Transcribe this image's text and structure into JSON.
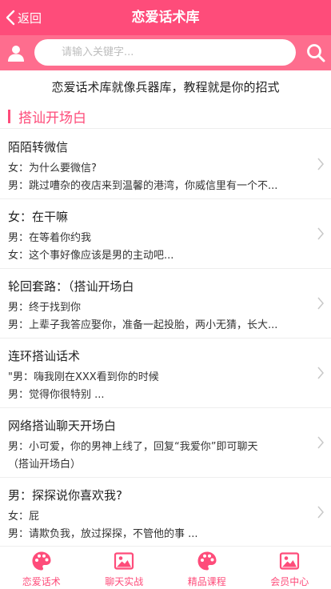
{
  "header": {
    "back_label": "返回",
    "title": "恋爱话术库",
    "back_icon": "chevron-left-icon"
  },
  "search": {
    "placeholder": "请输入关键字...",
    "value": "",
    "user_icon": "user-icon",
    "search_icon": "search-icon"
  },
  "slogan": "恋爱话术库就像兵器库，教程就是你的招式",
  "section": {
    "title": "搭讪开场白"
  },
  "items": [
    {
      "title": "陌陌转微信",
      "line1": "女：为什么要微信?",
      "line2": "男：跳过嘈杂的夜店来到温馨的港湾，你威信里有一个不..."
    },
    {
      "title": "女：在干嘛",
      "line1": "男：在等着你约我",
      "line2": "女：这个事好像应该是男的主动吧..."
    },
    {
      "title": "轮回套路：（搭讪开场白",
      "line1": "男：终于找到你",
      "line2": "男：上辈子我答应娶你，准备一起投胎，两小无猜，长大..."
    },
    {
      "title": "连环搭讪话术",
      "line1": "\"男：嗨我刚在XXX看到你的时候",
      "line2": "男：觉得你很特别 ..."
    },
    {
      "title": "网络搭讪聊天开场白",
      "line1": "男：小可爱，你的男神上线了，回复“我爱你”即可聊天",
      "line2": "（搭讪开场白）"
    },
    {
      "title": "男：探探说你喜欢我?",
      "line1": "女：屁",
      "line2": "男：请欺负我，放过探探，不管他的事 ..."
    }
  ],
  "tabs": [
    {
      "label": "恋爱话术",
      "icon": "palette-icon"
    },
    {
      "label": "聊天实战",
      "icon": "image-icon"
    },
    {
      "label": "精品课程",
      "icon": "palette-icon"
    },
    {
      "label": "会员中心",
      "icon": "image-icon"
    }
  ],
  "colors": {
    "brand": "#fe4c7a",
    "search_bar": "#fe6d8e"
  }
}
